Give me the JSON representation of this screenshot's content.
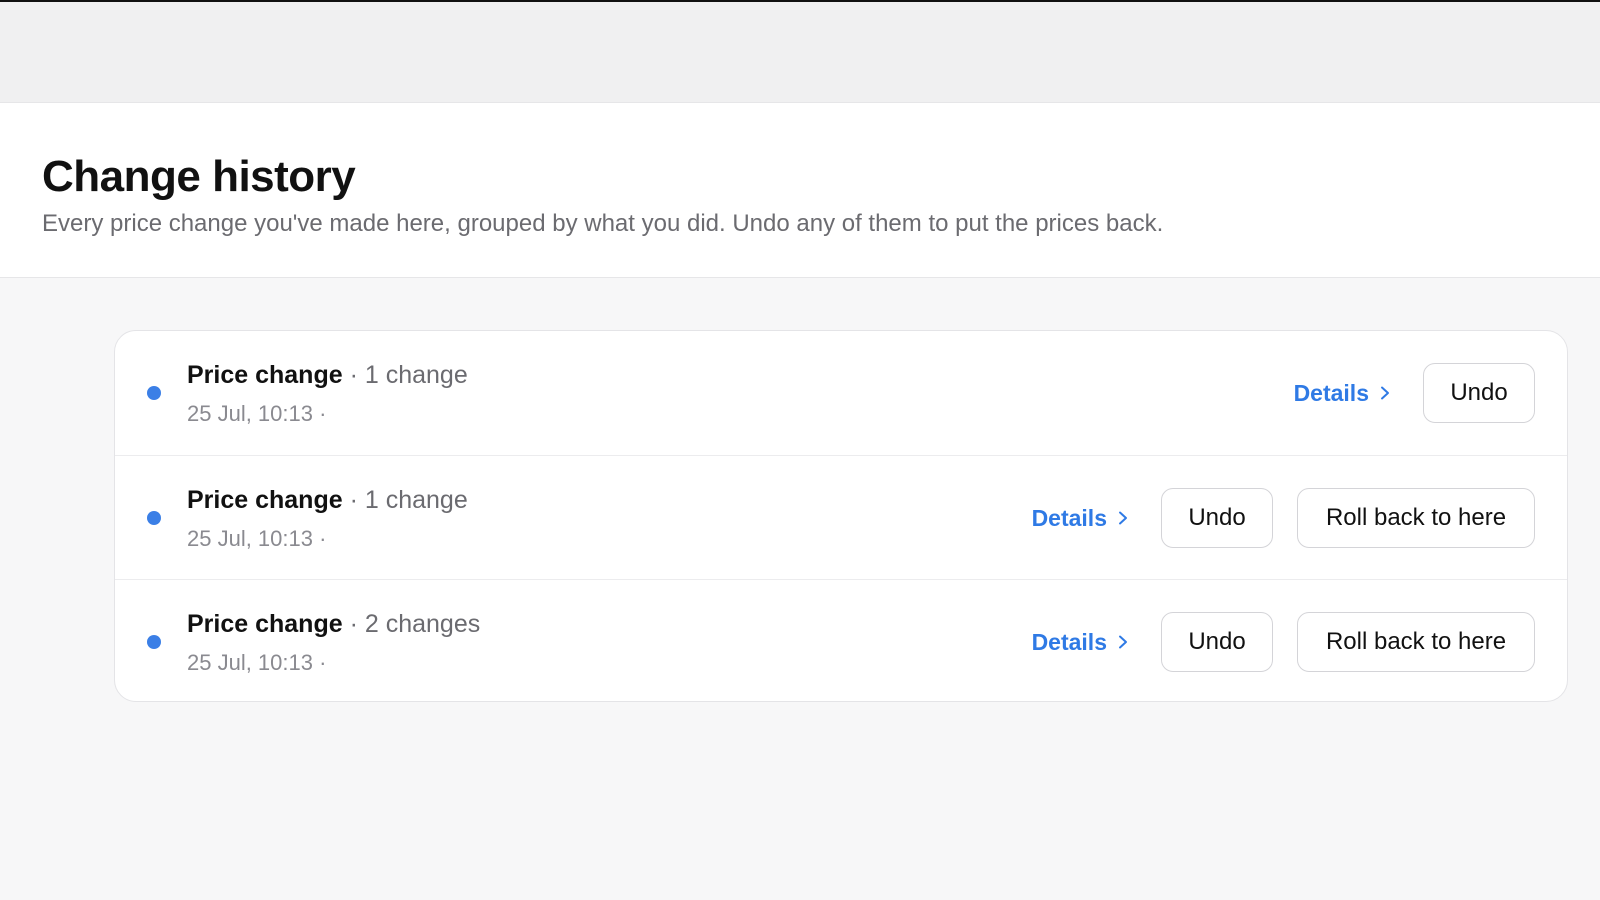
{
  "header": {
    "title": "Change history",
    "subtitle": "Every price change you've made here, grouped by what you did. Undo any of them to put the prices back."
  },
  "colors": {
    "accent": "#2f7ae5",
    "dot": "#3b7fe6",
    "muted": "#6b6b70"
  },
  "icons": {
    "status": "status-dot-icon",
    "details": "chevron-right-icon"
  },
  "entries": [
    {
      "kind": "Price change",
      "separator": "·",
      "count": "1 change",
      "date": "25 Jul, 10:13 ·",
      "details_label": "Details",
      "undo_label": "Undo"
    },
    {
      "kind": "Price change",
      "separator": "·",
      "count": "1 change",
      "date": "25 Jul, 10:13 ·",
      "details_label": "Details",
      "undo_label": "Undo",
      "rollback_label": "Roll back to here"
    },
    {
      "kind": "Price change",
      "separator": "·",
      "count": "2 changes",
      "date": "25 Jul, 10:13 ·",
      "details_label": "Details",
      "undo_label": "Undo",
      "rollback_label": "Roll back to here"
    }
  ]
}
